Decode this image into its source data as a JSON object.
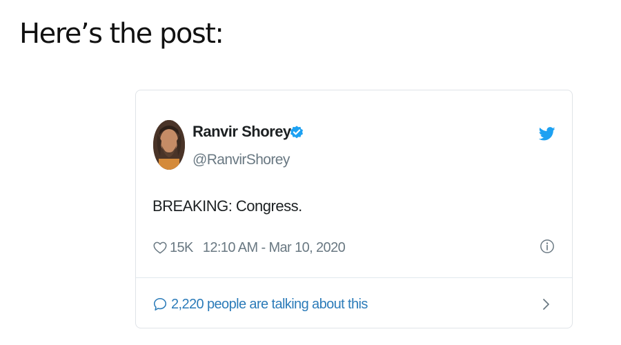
{
  "heading": "Here’s the post:",
  "tweet": {
    "author_name": "Ranvir Shorey",
    "author_handle": "@RanvirShorey",
    "verified": true,
    "text": "BREAKING: Congress.",
    "like_count": "15K",
    "timestamp": "12:10 AM - Mar 10, 2020",
    "conversation_text": "2,220 people are talking about this"
  },
  "icons": {
    "verified": "verified-badge-icon",
    "brand": "twitter-bird-icon",
    "like": "heart-icon",
    "info": "info-icon",
    "conversation": "speech-bubble-icon",
    "chevron": "chevron-right-icon"
  },
  "colors": {
    "twitter_blue": "#1da1f2",
    "link_blue": "#2b7bb9",
    "muted_text": "#697882",
    "main_text": "#1c2022",
    "card_border": "#dfe3e7"
  }
}
